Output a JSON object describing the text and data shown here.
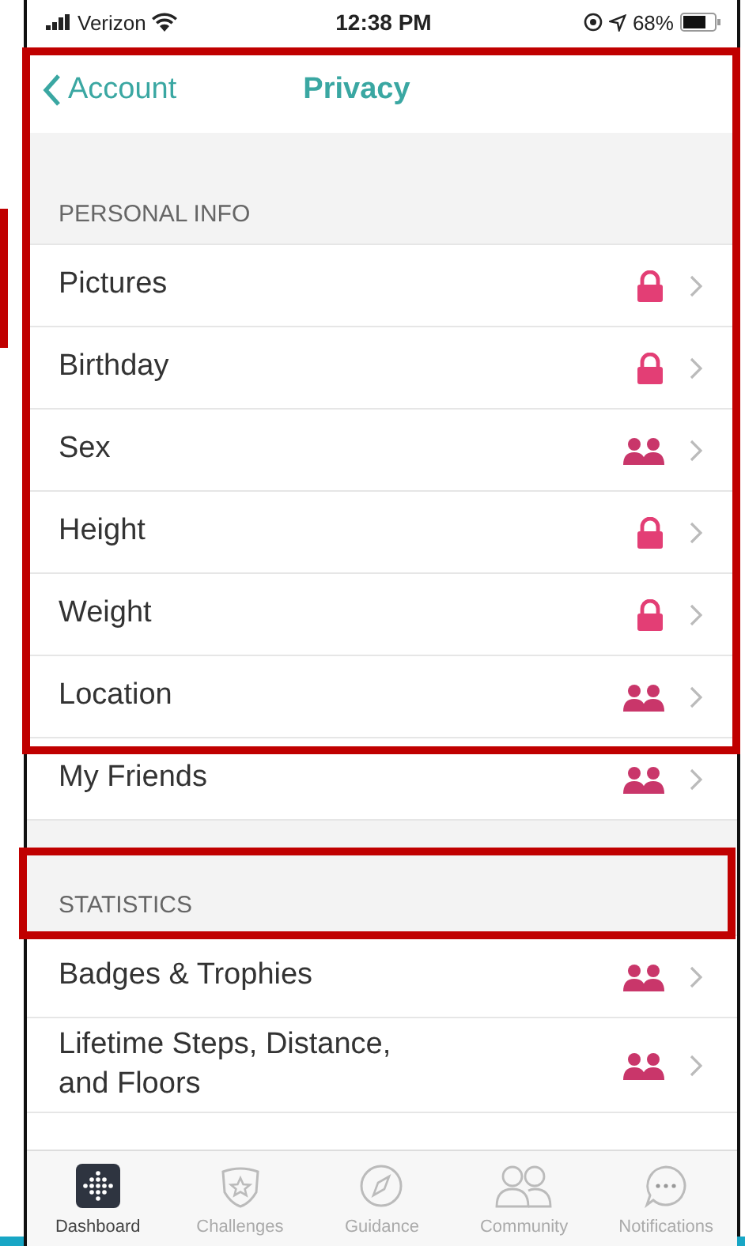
{
  "status_bar": {
    "carrier": "Verizon",
    "time": "12:38 PM",
    "battery": "68%"
  },
  "nav": {
    "back": "Account",
    "title": "Privacy"
  },
  "sections": [
    {
      "header": "PERSONAL INFO",
      "rows": [
        {
          "label": "Pictures",
          "kind": "private"
        },
        {
          "label": "Birthday",
          "kind": "private"
        },
        {
          "label": "Sex",
          "kind": "friends"
        },
        {
          "label": "Height",
          "kind": "private"
        },
        {
          "label": "Weight",
          "kind": "private"
        },
        {
          "label": "Location",
          "kind": "friends"
        },
        {
          "label": "My Friends",
          "kind": "friends"
        }
      ]
    },
    {
      "header": "STATISTICS",
      "rows": [
        {
          "label": "Badges & Trophies",
          "kind": "friends"
        },
        {
          "label": "Lifetime Steps, Distance, and Floors",
          "kind": "friends"
        }
      ]
    }
  ],
  "tabs": [
    {
      "label": "Dashboard",
      "kind": "dashboard",
      "selected": true
    },
    {
      "label": "Challenges",
      "kind": "challenges",
      "selected": false
    },
    {
      "label": "Guidance",
      "kind": "guidance",
      "selected": false
    },
    {
      "label": "Community",
      "kind": "community",
      "selected": false
    },
    {
      "label": "Notifications",
      "kind": "notifications",
      "selected": false
    }
  ]
}
